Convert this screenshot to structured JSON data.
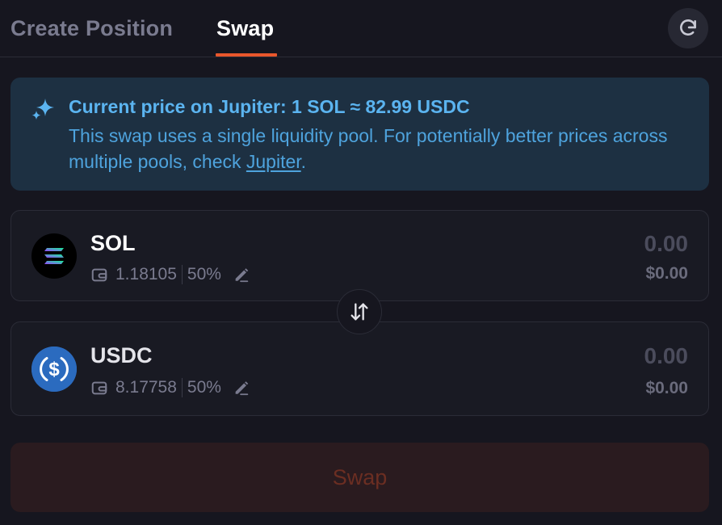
{
  "tabs": {
    "create_position": "Create Position",
    "swap": "Swap",
    "active": "swap"
  },
  "banner": {
    "title": "Current price on Jupiter: 1 SOL ≈ 82.99 USDC",
    "body_text": "This swap uses a single liquidity pool. For potentially better prices across multiple pools, check ",
    "link_text": "Jupiter",
    "body_end": "."
  },
  "from_token": {
    "symbol": "SOL",
    "balance": "1.18105",
    "percent": "50%",
    "amount": "0.00",
    "amount_usd": "$0.00"
  },
  "to_token": {
    "symbol": "USDC",
    "balance": "8.17758",
    "percent": "50%",
    "amount": "0.00",
    "amount_usd": "$0.00"
  },
  "swap_button": {
    "label": "Swap",
    "enabled": false
  },
  "icons": {
    "refresh": "refresh-icon",
    "banner": "sparkle-icon",
    "wallet": "wallet-icon",
    "edit": "pencil-icon",
    "flip": "swap-vertical-icon"
  },
  "colors": {
    "accent": "#e9572c",
    "info_text": "#5bb4f0",
    "info_bg": "#1d3042"
  }
}
